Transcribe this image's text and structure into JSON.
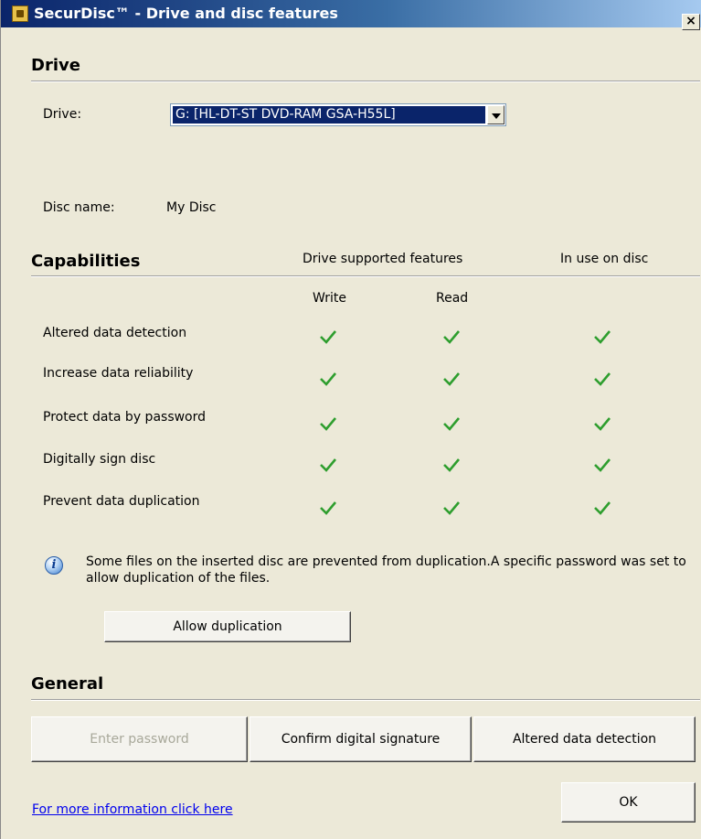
{
  "window": {
    "title": "SecurDisc™ - Drive and disc features",
    "close_label": "×"
  },
  "drive_section": {
    "title": "Drive",
    "drive_label": "Drive:",
    "drive_value": "G: [HL-DT-ST DVD-RAM GSA-H55L]",
    "disc_name_label": "Disc name:",
    "disc_name_value": "My Disc"
  },
  "capabilities": {
    "title": "Capabilities",
    "col_group_drive": "Drive supported features",
    "col_group_disc": "In use on disc",
    "col_write": "Write",
    "col_read": "Read",
    "rows": [
      {
        "label": "Altered data detection",
        "write": true,
        "read": true,
        "in_use": true
      },
      {
        "label": "Increase data reliability",
        "write": true,
        "read": true,
        "in_use": true
      },
      {
        "label": "Protect data by password",
        "write": true,
        "read": true,
        "in_use": true
      },
      {
        "label": "Digitally sign disc",
        "write": true,
        "read": true,
        "in_use": true
      },
      {
        "label": "Prevent data duplication",
        "write": true,
        "read": true,
        "in_use": true
      }
    ],
    "check_color": "#2e9e2e"
  },
  "info": {
    "message": "Some files on the inserted disc are prevented from duplication.A specific password was set to allow duplication of the files.",
    "allow_button": "Allow duplication"
  },
  "general": {
    "title": "General",
    "enter_password": "Enter password",
    "confirm_signature": "Confirm digital signature",
    "altered_detection": "Altered data detection"
  },
  "footer": {
    "more_info_link": "For more information click here",
    "ok_button": "OK"
  }
}
